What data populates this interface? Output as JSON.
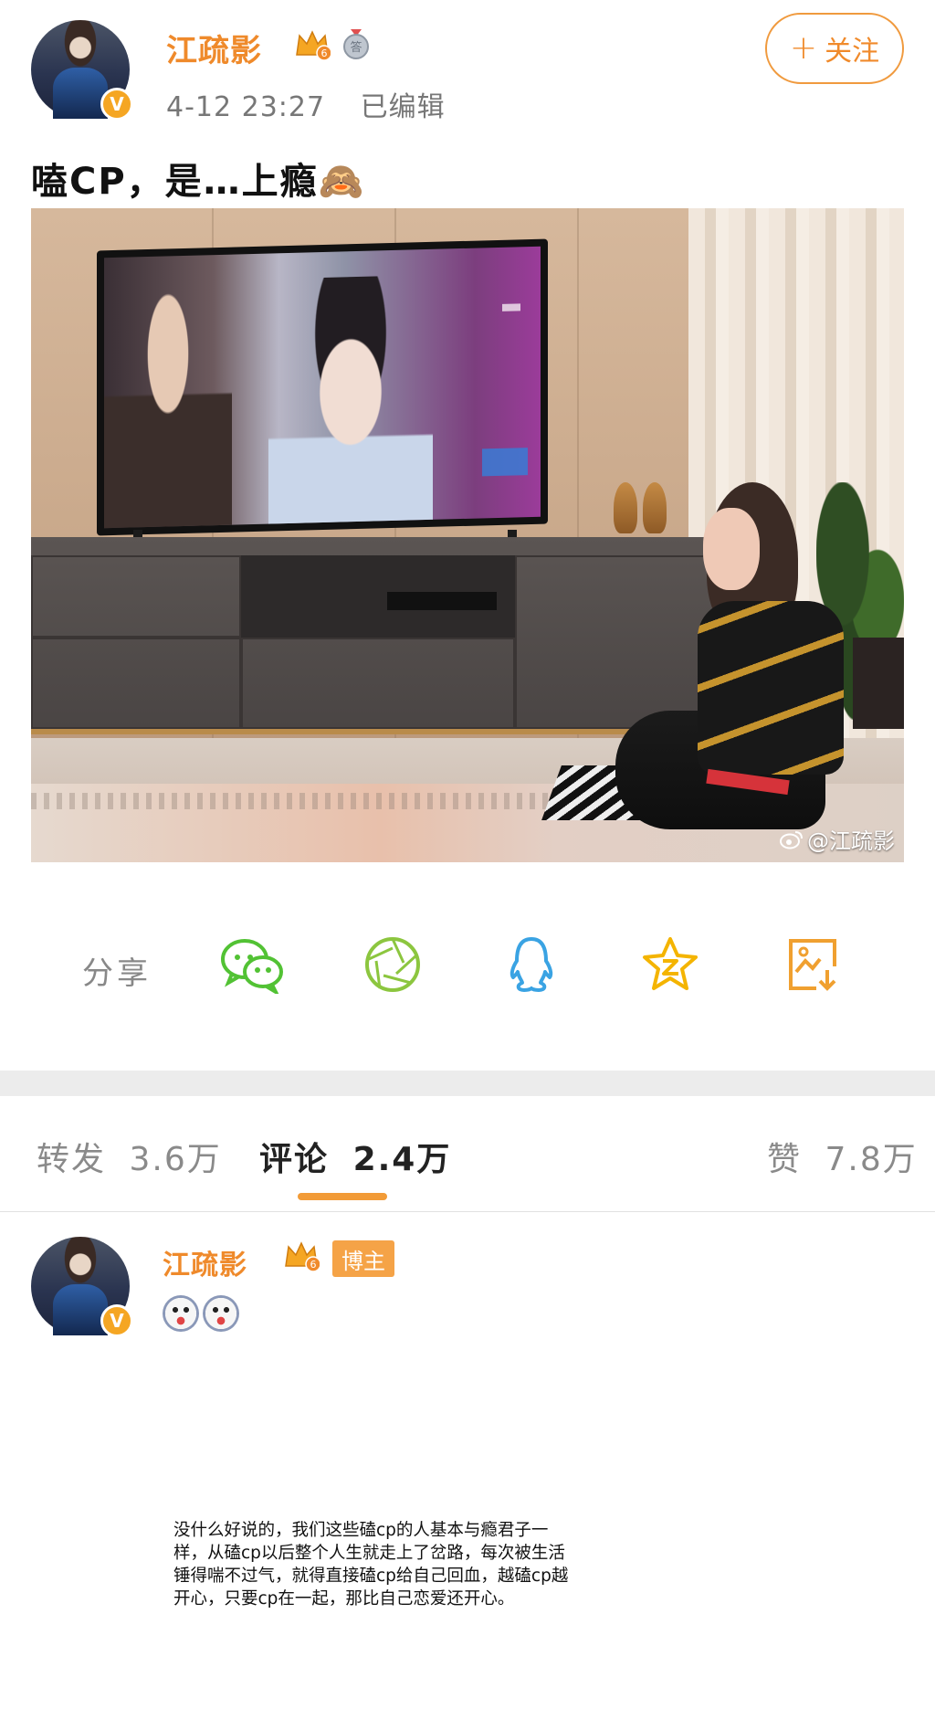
{
  "post": {
    "author": {
      "name": "江疏影",
      "vip_level": "6",
      "verified_mark": "V"
    },
    "meta": {
      "time": "4-12 23:27",
      "edited": "已编辑"
    },
    "follow_label": "关注",
    "follow_plus": "+",
    "text": "嗑CP，是…上瘾🙈",
    "image": {
      "watermark": "@江疏影"
    }
  },
  "share": {
    "label": "分享",
    "icons": [
      "wechat-icon",
      "moments-icon",
      "qq-icon",
      "qzone-icon",
      "save-image-icon"
    ]
  },
  "tabs": {
    "repost": {
      "label": "转发",
      "count": "3.6万"
    },
    "comment": {
      "label": "评论",
      "count": "2.4万"
    },
    "like": {
      "label": "赞",
      "count": "7.8万"
    }
  },
  "comment": {
    "author": "江疏影",
    "vip_level": "6",
    "badge": "博主",
    "emoji_count": 2
  },
  "quote_text": "没什么好说的，我们这些磕cp的人基本与瘾君子一样，从磕cp以后整个人生就走上了岔路，每次被生活锤得喘不过气，就得直接磕cp给自己回血，越磕cp越开心，只要cp在一起，那比自己恋爱还开心。",
  "colors": {
    "accent_orange": "#ef8a2b",
    "wechat_green": "#52c234",
    "moments_green": "#8cc63f",
    "qq_blue": "#3aa3e3",
    "qzone_yellow": "#f4b400",
    "save_orange": "#f0a030"
  }
}
